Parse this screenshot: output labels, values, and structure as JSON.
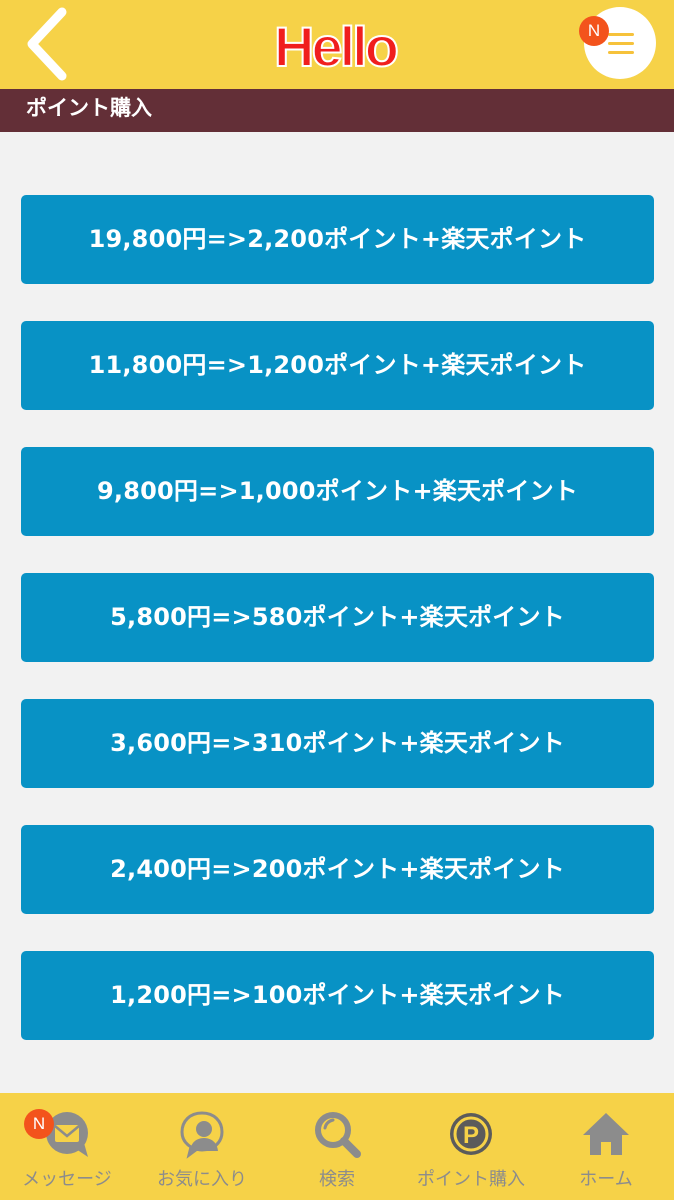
{
  "header": {
    "logo_text": "Hello",
    "menu_badge": "N"
  },
  "page_title": "ポイント購入",
  "plans": [
    {
      "label": "19,800円=>2,200ポイント+楽天ポイント"
    },
    {
      "label": "11,800円=>1,200ポイント+楽天ポイント"
    },
    {
      "label": "9,800円=>1,000ポイント+楽天ポイント"
    },
    {
      "label": "5,800円=>580ポイント+楽天ポイント"
    },
    {
      "label": "3,600円=>310ポイント+楽天ポイント"
    },
    {
      "label": "2,400円=>200ポイント+楽天ポイント"
    },
    {
      "label": "1,200円=>100ポイント+楽天ポイント"
    }
  ],
  "tabs": [
    {
      "label": "メッセージ",
      "icon": "message-icon",
      "badge": "N"
    },
    {
      "label": "お気に入り",
      "icon": "favorite-icon"
    },
    {
      "label": "検索",
      "icon": "search-icon"
    },
    {
      "label": "ポイント購入",
      "icon": "point-icon"
    },
    {
      "label": "ホーム",
      "icon": "home-icon"
    }
  ],
  "colors": {
    "header_bg": "#f6d248",
    "title_bar_bg": "#632f37",
    "button_bg": "#0892c5",
    "badge_bg": "#f3531c",
    "logo_red": "#f01e1e",
    "icon_gray": "#8c8c8c"
  }
}
